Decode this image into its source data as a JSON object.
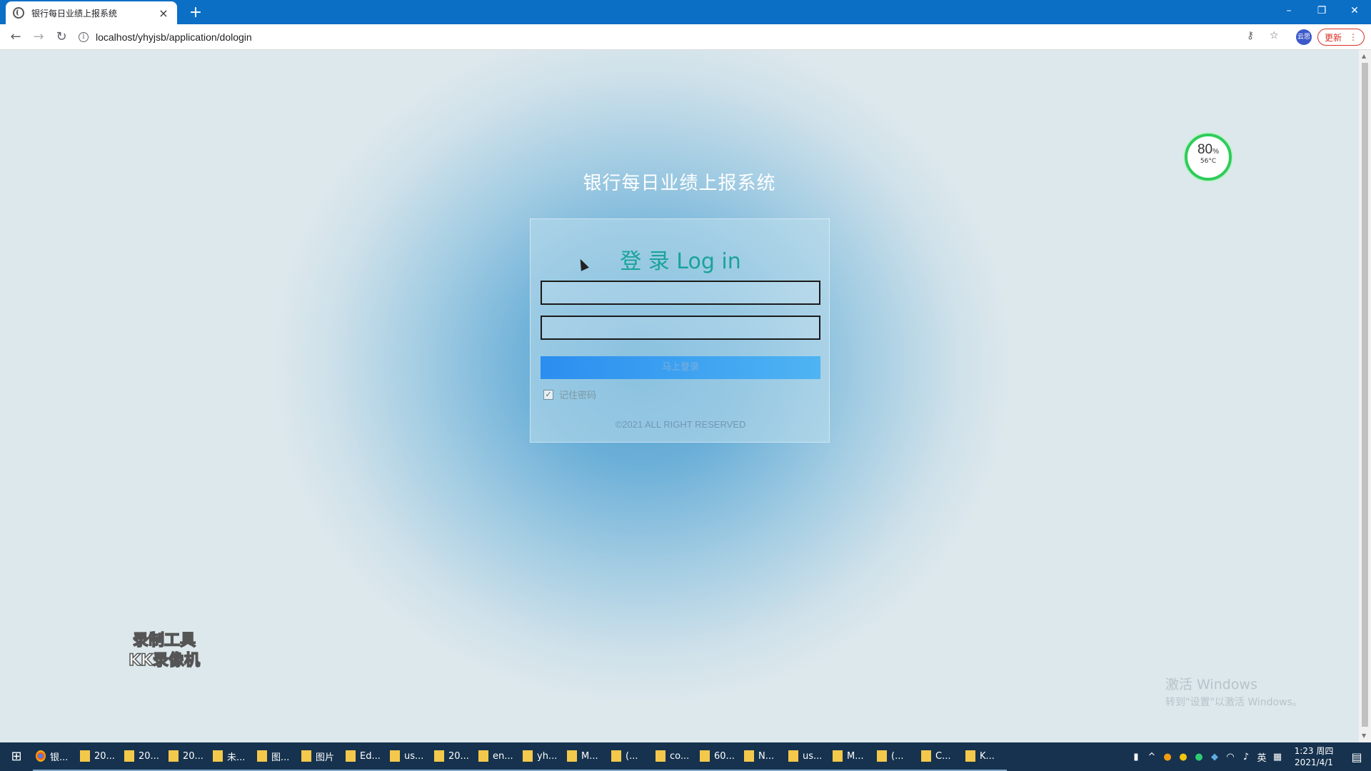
{
  "browser": {
    "tab_title": "银行每日业绩上报系统",
    "tab_close": "×",
    "new_tab": "+",
    "url": "localhost/yhyjsb/application/dologin",
    "profile_label": "云思",
    "update_label": "更新",
    "menu_icon": "⋮",
    "window_controls": [
      "–",
      "❐",
      "✕"
    ]
  },
  "page": {
    "system_title": "银行每日业绩上报系统",
    "login_heading": "登 录 Log in",
    "username_value": "",
    "password_value": "",
    "login_button": "马上登录",
    "remember_label": "记住密码",
    "remember_checked": true,
    "copyright": "©2021 ALL RIGHT RESERVED"
  },
  "overlays": {
    "cpu_percent": "80",
    "cpu_percent_unit": "%",
    "cpu_temp": "56°C",
    "watermark_line1": "录制工具",
    "watermark_line2": "KK录像机",
    "activate_line1": "激活 Windows",
    "activate_line2": "转到\"设置\"以激活 Windows。"
  },
  "taskbar": {
    "items": [
      "银...",
      "20...",
      "20...",
      "20...",
      "未...",
      "图...",
      "图片",
      "Ed...",
      "us...",
      "20...",
      "en...",
      "yh...",
      "M...",
      "(...",
      "co...",
      "60...",
      "N...",
      "us...",
      "M...",
      "(...",
      "C...",
      "K..."
    ],
    "ime": "英",
    "time": "1:23 周四",
    "date": "2021/4/1"
  },
  "colors": {
    "titlebar": "#0b6fc6",
    "heading": "#1aa39a",
    "login_button": "#2b8ef0",
    "taskbar": "#16324e"
  }
}
